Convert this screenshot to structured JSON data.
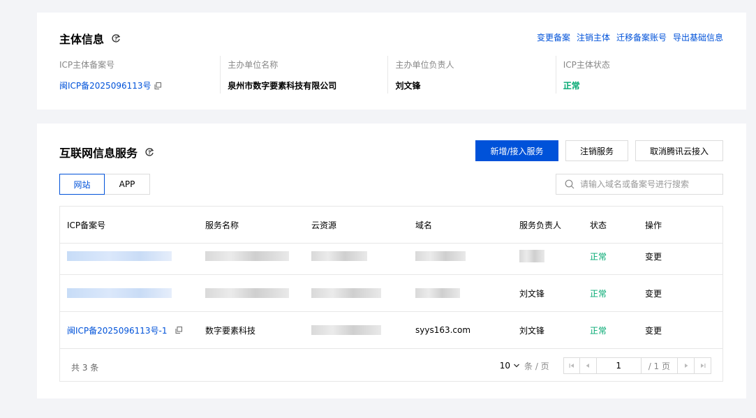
{
  "subject": {
    "title": "主体信息",
    "links": [
      "变更备案",
      "注销主体",
      "迁移备案账号",
      "导出基础信息"
    ],
    "fields": [
      {
        "label": "ICP主体备案号",
        "value": "闽ICP备2025096113号"
      },
      {
        "label": "主办单位名称",
        "value": "泉州市数字要素科技有限公司"
      },
      {
        "label": "主办单位负责人",
        "value": "刘文锋"
      },
      {
        "label": "ICP主体状态",
        "value": "正常"
      }
    ]
  },
  "services": {
    "title": "互联网信息服务",
    "buttons": {
      "add": "新增/接入服务",
      "cancel_service": "注销服务",
      "cancel_access": "取消腾讯云接入"
    },
    "tabs": [
      "网站",
      "APP"
    ],
    "search_placeholder": "请输入域名或备案号进行搜索",
    "columns": [
      "ICP备案号",
      "服务名称",
      "云资源",
      "域名",
      "服务负责人",
      "状态",
      "操作"
    ],
    "rows": [
      {
        "icp": "",
        "name": "",
        "resource": "",
        "domain": "",
        "owner": "",
        "status": "正常",
        "action": "变更"
      },
      {
        "icp": "",
        "name": "",
        "resource": "",
        "domain": "",
        "owner": "刘文锋",
        "status": "正常",
        "action": "变更"
      },
      {
        "icp": "闽ICP备2025096113号-1",
        "name": "数字要素科技",
        "resource": "",
        "domain": "syys163.com",
        "owner": "刘文锋",
        "status": "正常",
        "action": "变更"
      }
    ],
    "pagination": {
      "total": "共 3 条",
      "page_size": "10",
      "page_size_unit": "条 / 页",
      "current_page": "1",
      "total_pages": "/ 1 页"
    }
  },
  "colors": {
    "accent": "#0052d9",
    "success": "#00a870"
  }
}
